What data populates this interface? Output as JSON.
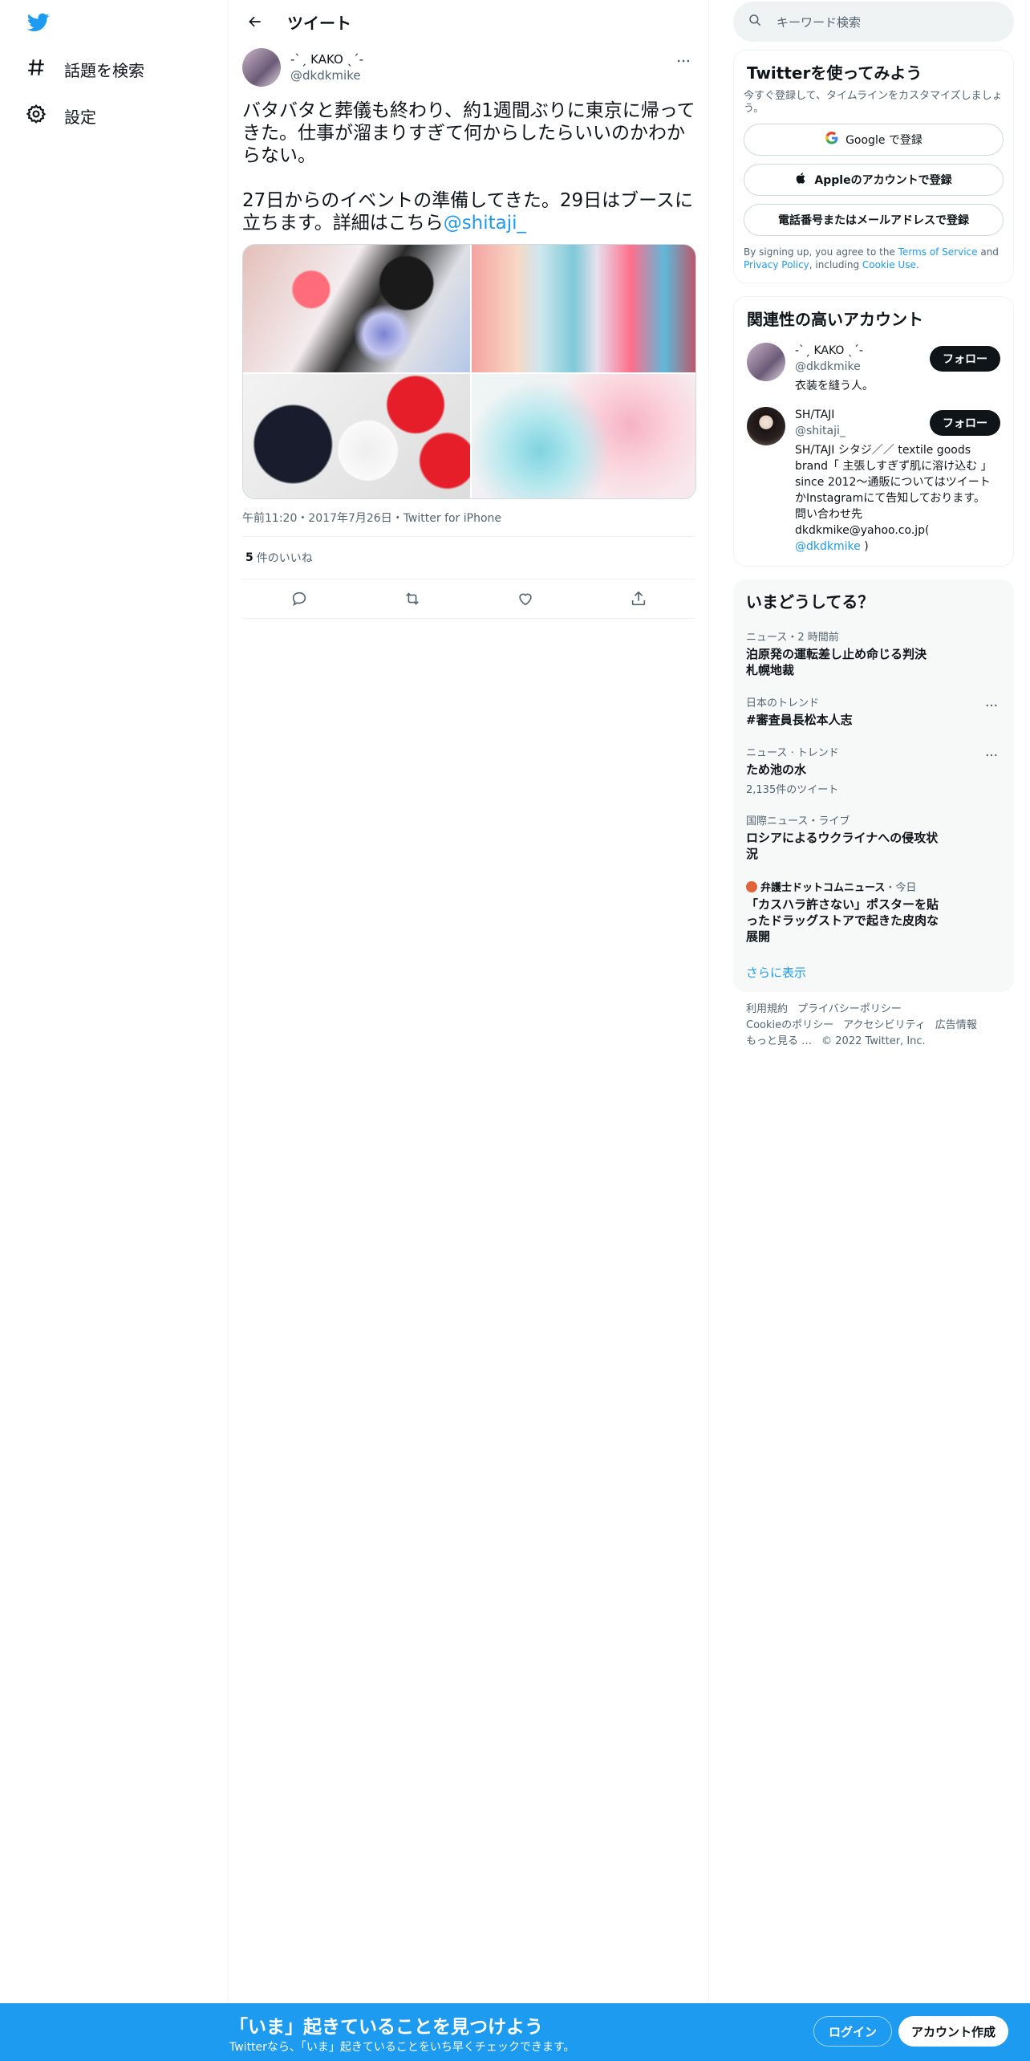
{
  "nav": {
    "items": [
      {
        "label": "話題を検索",
        "icon": "hashtag-icon"
      },
      {
        "label": "設定",
        "icon": "gear-icon"
      }
    ]
  },
  "header": {
    "title": "ツイート"
  },
  "tweet": {
    "display_name": "-ˋˏ KAKO ˎˊ-",
    "username": "@dkdkmike",
    "text": "バタバタと葬儀も終わり、約1週間ぶりに東京に帰ってきた。仕事が溜まりすぎて何からしたらいいのかわからない。\n\n27日からのイベントの準備してきた。29日はブースに立ちます。詳細はこちら",
    "mention": "@shitaji_",
    "meta": "午前11:20・2017年7月26日・Twitter for iPhone",
    "likes_count": "5",
    "likes_label": "件のいいね"
  },
  "search": {
    "placeholder": "キーワード検索"
  },
  "signup": {
    "title": "Twitterを使ってみよう",
    "subtitle": "今すぐ登録して、タイムラインをカスタマイズしましょう。",
    "google_label": "Google で登録",
    "apple_label": "Appleのアカウントで登録",
    "phone_label": "電話番号またはメールアドレスで登録",
    "terms_prefix": "By signing up, you agree to the ",
    "terms_link": "Terms of Service",
    "terms_and": " and ",
    "privacy_link": "Privacy Policy",
    "terms_including": ", including ",
    "cookie_link": "Cookie Use",
    "terms_end": "."
  },
  "related": {
    "title": "関連性の高いアカウント",
    "follow_label": "フォロー",
    "accounts": [
      {
        "name": "-ˋˏ KAKO ˎˊ-",
        "handle": "@dkdkmike",
        "bio": "衣装を縫う人。"
      },
      {
        "name": "SH/TAJI",
        "handle": "@shitaji_",
        "bio": "SH/TAJI シタジ／／ textile goods brand「 主張しすぎず肌に溶け込む 」since 2012〜通販についてはツイートかInstagramにて告知しております。問い合わせ先 dkdkmike@yahoo.co.jp( ",
        "bio_link": "@dkdkmike",
        "bio_end": " )"
      }
    ]
  },
  "trends": {
    "title": "いまどうしてる？",
    "items": [
      {
        "context": "ニュース・2 時間前",
        "title": "泊原発の運転差し止め命じる判決　札幌地裁",
        "count": ""
      },
      {
        "context": "日本のトレンド",
        "title": "#審査員長松本人志",
        "count": ""
      },
      {
        "context": "ニュース · トレンド",
        "title": "ため池の水",
        "count": "2,135件のツイート"
      },
      {
        "context": "国際ニュース・ライブ",
        "title": "ロシアによるウクライナへの侵攻状況",
        "count": ""
      },
      {
        "context_source": "弁護士ドットコムニュース",
        "context": "・今日",
        "title": "「カスハラ許さない」ポスターを貼ったドラッグストアで起きた皮肉な展開",
        "count": ""
      }
    ],
    "show_more": "さらに表示"
  },
  "footer": {
    "links": [
      "利用規約",
      "プライバシーポリシー",
      "Cookieのポリシー",
      "アクセシビリティ",
      "広告情報",
      "もっと見る …"
    ],
    "copyright": "© 2022 Twitter, Inc."
  },
  "bottom": {
    "title": "「いま」起きていることを見つけよう",
    "subtitle": "Twitterなら、「いま」起きていることをいち早くチェックできます。",
    "login": "ログイン",
    "signup": "アカウント作成"
  },
  "colors": {
    "accent": "#1d9bf0",
    "text": "#0f1419",
    "secondary": "#536471"
  }
}
